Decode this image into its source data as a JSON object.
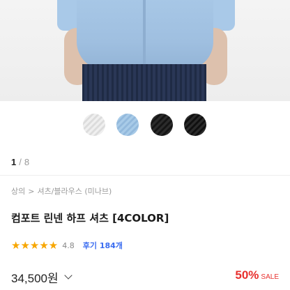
{
  "product": {
    "image_index": "1",
    "image_separator": "/",
    "image_total": "8",
    "swatches": [
      {
        "name": "light-gray",
        "color": "#e4e4e4"
      },
      {
        "name": "sky-blue",
        "color": "#a0c4e4"
      },
      {
        "name": "black",
        "color": "#1e1e1e"
      },
      {
        "name": "charcoal",
        "color": "#1a1a1a"
      }
    ],
    "breadcrumb": [
      "상의",
      "셔츠/블라우스 (미나브)"
    ],
    "breadcrumb_separator": ">",
    "title": "컴포트 린넨 하프 셔츠 [4COLOR]",
    "rating": {
      "stars": "★★★★★",
      "score": "4.8",
      "review_label": "후기 184개"
    },
    "price": "34,500원",
    "discount": "50%",
    "discount_label": "SALE"
  },
  "colors": {
    "accent_red": "#e8302e",
    "star": "#f7a600",
    "review_link": "#3a6cf0"
  }
}
